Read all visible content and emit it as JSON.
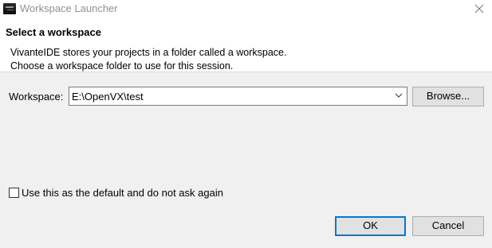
{
  "window": {
    "title": "Workspace Launcher"
  },
  "header": {
    "title": "Select a workspace",
    "description_line1": "VivanteIDE stores your projects in a folder called a workspace.",
    "description_line2": "Choose a workspace folder to use for this session."
  },
  "workspace": {
    "label": "Workspace:",
    "value": "E:\\OpenVX\\test",
    "browse_label": "Browse..."
  },
  "options": {
    "default_checkbox_label": "Use this as the default and do not ask again",
    "default_checked": false
  },
  "actions": {
    "ok_label": "OK",
    "cancel_label": "Cancel"
  },
  "colors": {
    "focus_border": "#0078d7",
    "dialog_bg": "#f0f0f0",
    "header_bg": "#ffffff"
  }
}
